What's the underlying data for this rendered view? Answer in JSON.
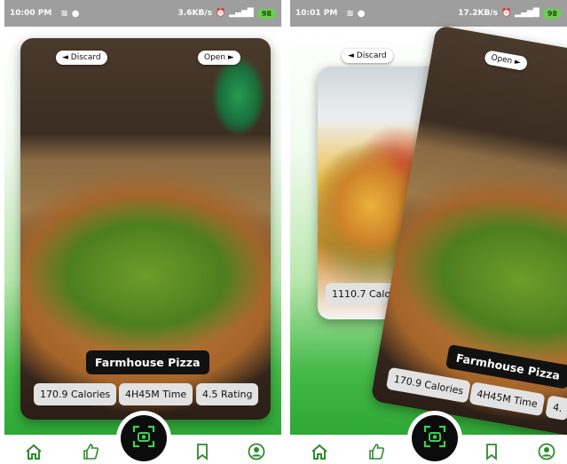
{
  "status_left": {
    "time": "10:00 PM",
    "speed": "3.6KB/s",
    "battery": "98"
  },
  "status_right": {
    "time": "10:01 PM",
    "speed": "17.2KB/s",
    "battery": "98"
  },
  "card_controls": {
    "discard_label": "◄ Discard",
    "open_label": "Open ►"
  },
  "current_dish": {
    "name": "Farmhouse Pizza",
    "calories": "170.9 Calories",
    "time": "4H45M Time",
    "rating": "4.5 Rating",
    "rating_partial": "4."
  },
  "next_dish": {
    "calories_partial": "1110.7 Calor"
  },
  "nav": {
    "items": [
      "home-icon",
      "thumbs-up-icon",
      "scan-icon",
      "bookmark-icon",
      "profile-icon"
    ]
  },
  "colors": {
    "accent_green": "#2ea836",
    "scan_icon_green": "#39d353",
    "nav_icon_green": "#2e8b2e"
  }
}
